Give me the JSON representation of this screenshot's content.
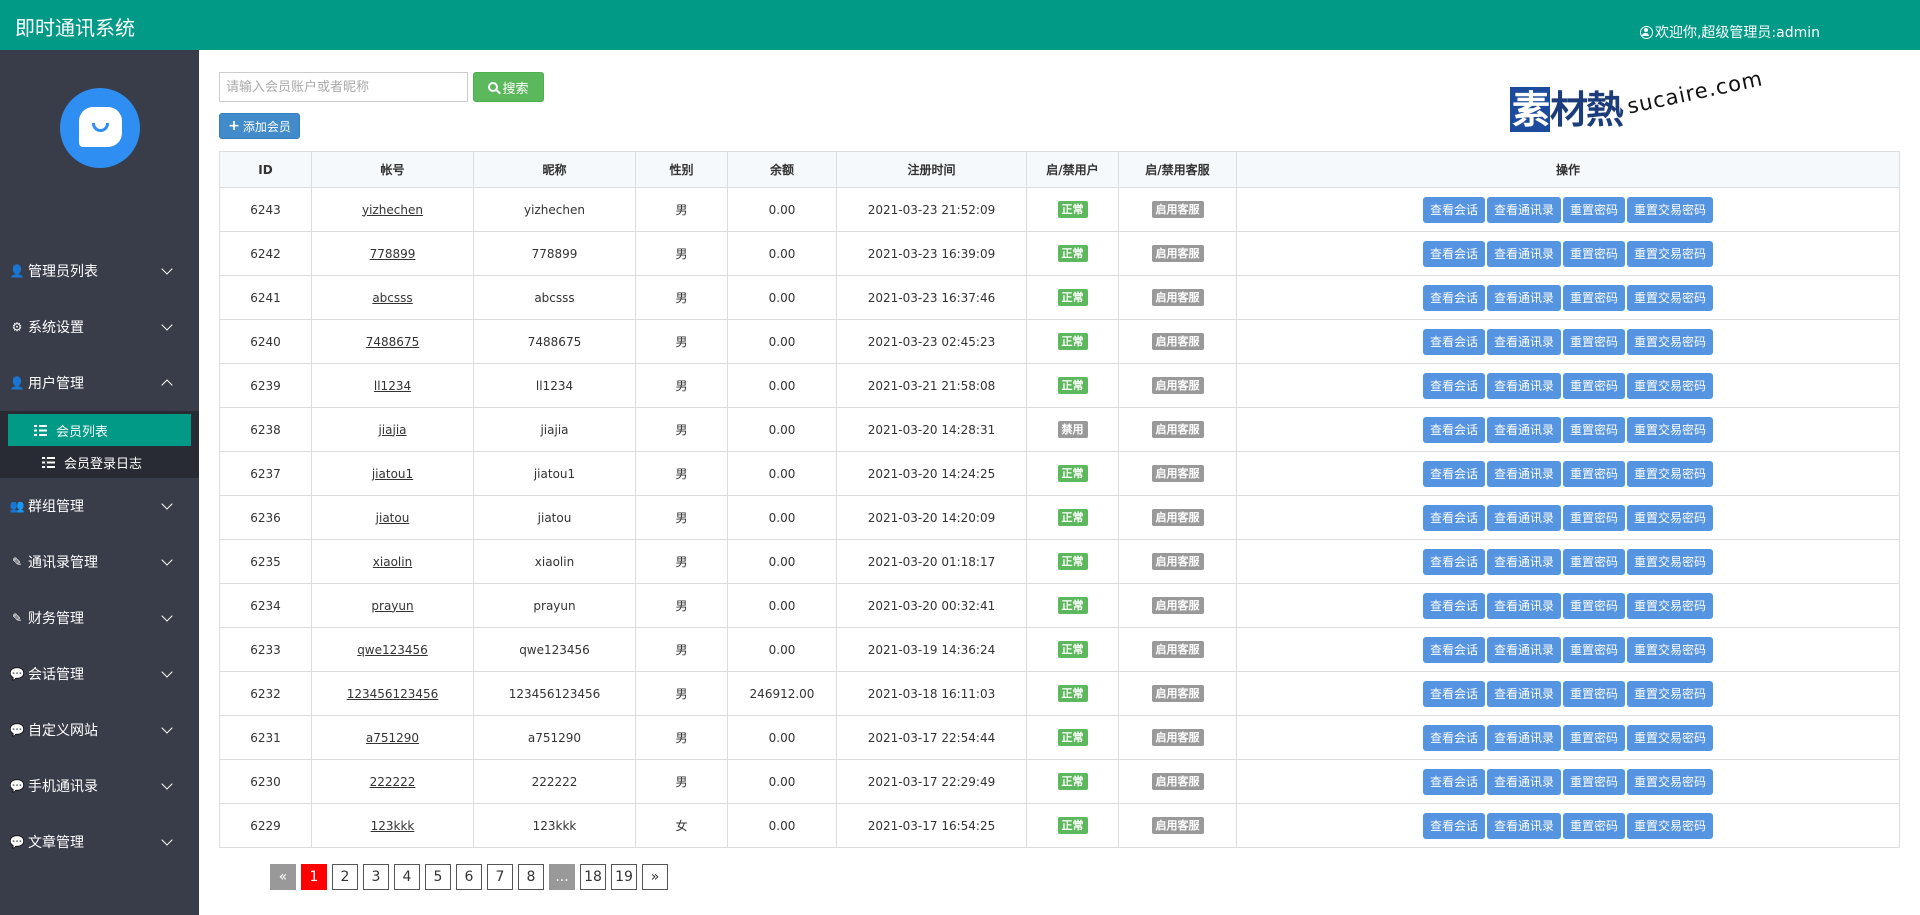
{
  "app": {
    "title": "即时通讯系统",
    "welcome": "欢迎你,超级管理员:admin",
    "accent": "#009a86"
  },
  "sidebar": {
    "items": [
      {
        "label": "管理员列表",
        "icon": "user-icon",
        "expanded": false
      },
      {
        "label": "系统设置",
        "icon": "gear-icon",
        "expanded": false
      },
      {
        "label": "用户管理",
        "icon": "user-icon",
        "expanded": true,
        "children": [
          {
            "label": "会员列表",
            "active": true
          },
          {
            "label": "会员登录日志",
            "active": false
          }
        ]
      },
      {
        "label": "群组管理",
        "icon": "group-icon",
        "expanded": false
      },
      {
        "label": "通讯录管理",
        "icon": "edit-icon",
        "expanded": false
      },
      {
        "label": "财务管理",
        "icon": "edit-icon",
        "expanded": false
      },
      {
        "label": "会话管理",
        "icon": "chat-icon",
        "expanded": false
      },
      {
        "label": "自定义网站",
        "icon": "chat-icon",
        "expanded": false
      },
      {
        "label": "手机通讯录",
        "icon": "chat-icon",
        "expanded": false
      },
      {
        "label": "文章管理",
        "icon": "chat-icon",
        "expanded": false
      }
    ]
  },
  "toolbar": {
    "search_placeholder": "请输入会员账户或者昵称",
    "search_label": "搜索",
    "add_label": "添加会员"
  },
  "watermark": {
    "logo": "素材熱",
    "logo_first": "素",
    "logo_rest": "材熱",
    "url": "sucaire.com"
  },
  "table": {
    "headers": [
      "ID",
      "帐号",
      "昵称",
      "性别",
      "余额",
      "注册时间",
      "启/禁用户",
      "启/禁用客服",
      "操作"
    ],
    "actions": [
      "查看会话",
      "查看通讯录",
      "重置密码",
      "重置交易密码"
    ],
    "rows": [
      {
        "id": "6243",
        "account": "yizhechen",
        "nickname": "yizhechen",
        "gender": "男",
        "balance": "0.00",
        "registered": "2021-03-23 21:52:09",
        "user_status": "正常",
        "user_status_ok": true,
        "cs_status": "启用客服"
      },
      {
        "id": "6242",
        "account": "778899",
        "nickname": "778899",
        "gender": "男",
        "balance": "0.00",
        "registered": "2021-03-23 16:39:09",
        "user_status": "正常",
        "user_status_ok": true,
        "cs_status": "启用客服"
      },
      {
        "id": "6241",
        "account": "abcsss",
        "nickname": "abcsss",
        "gender": "男",
        "balance": "0.00",
        "registered": "2021-03-23 16:37:46",
        "user_status": "正常",
        "user_status_ok": true,
        "cs_status": "启用客服"
      },
      {
        "id": "6240",
        "account": "7488675",
        "nickname": "7488675",
        "gender": "男",
        "balance": "0.00",
        "registered": "2021-03-23 02:45:23",
        "user_status": "正常",
        "user_status_ok": true,
        "cs_status": "启用客服"
      },
      {
        "id": "6239",
        "account": "ll1234",
        "nickname": "ll1234",
        "gender": "男",
        "balance": "0.00",
        "registered": "2021-03-21 21:58:08",
        "user_status": "正常",
        "user_status_ok": true,
        "cs_status": "启用客服"
      },
      {
        "id": "6238",
        "account": "jiajia",
        "nickname": "jiajia",
        "gender": "男",
        "balance": "0.00",
        "registered": "2021-03-20 14:28:31",
        "user_status": "禁用",
        "user_status_ok": false,
        "cs_status": "启用客服"
      },
      {
        "id": "6237",
        "account": "jiatou1",
        "nickname": "jiatou1",
        "gender": "男",
        "balance": "0.00",
        "registered": "2021-03-20 14:24:25",
        "user_status": "正常",
        "user_status_ok": true,
        "cs_status": "启用客服"
      },
      {
        "id": "6236",
        "account": "jiatou",
        "nickname": "jiatou",
        "gender": "男",
        "balance": "0.00",
        "registered": "2021-03-20 14:20:09",
        "user_status": "正常",
        "user_status_ok": true,
        "cs_status": "启用客服"
      },
      {
        "id": "6235",
        "account": "xiaolin",
        "nickname": "xiaolin",
        "gender": "男",
        "balance": "0.00",
        "registered": "2021-03-20 01:18:17",
        "user_status": "正常",
        "user_status_ok": true,
        "cs_status": "启用客服"
      },
      {
        "id": "6234",
        "account": "prayun",
        "nickname": "prayun",
        "gender": "男",
        "balance": "0.00",
        "registered": "2021-03-20 00:32:41",
        "user_status": "正常",
        "user_status_ok": true,
        "cs_status": "启用客服"
      },
      {
        "id": "6233",
        "account": "qwe123456",
        "nickname": "qwe123456",
        "gender": "男",
        "balance": "0.00",
        "registered": "2021-03-19 14:36:24",
        "user_status": "正常",
        "user_status_ok": true,
        "cs_status": "启用客服"
      },
      {
        "id": "6232",
        "account": "123456123456",
        "nickname": "123456123456",
        "gender": "男",
        "balance": "246912.00",
        "registered": "2021-03-18 16:11:03",
        "user_status": "正常",
        "user_status_ok": true,
        "cs_status": "启用客服"
      },
      {
        "id": "6231",
        "account": "a751290",
        "nickname": "a751290",
        "gender": "男",
        "balance": "0.00",
        "registered": "2021-03-17 22:54:44",
        "user_status": "正常",
        "user_status_ok": true,
        "cs_status": "启用客服"
      },
      {
        "id": "6230",
        "account": "222222",
        "nickname": "222222",
        "gender": "男",
        "balance": "0.00",
        "registered": "2021-03-17 22:29:49",
        "user_status": "正常",
        "user_status_ok": true,
        "cs_status": "启用客服"
      },
      {
        "id": "6229",
        "account": "123kkk",
        "nickname": "123kkk",
        "gender": "女",
        "balance": "0.00",
        "registered": "2021-03-17 16:54:25",
        "user_status": "正常",
        "user_status_ok": true,
        "cs_status": "启用客服"
      }
    ]
  },
  "pagination": {
    "items": [
      {
        "label": "«",
        "kind": "muted"
      },
      {
        "label": "1",
        "kind": "active"
      },
      {
        "label": "2",
        "kind": ""
      },
      {
        "label": "3",
        "kind": ""
      },
      {
        "label": "4",
        "kind": ""
      },
      {
        "label": "5",
        "kind": ""
      },
      {
        "label": "6",
        "kind": ""
      },
      {
        "label": "7",
        "kind": ""
      },
      {
        "label": "8",
        "kind": ""
      },
      {
        "label": "...",
        "kind": "muted"
      },
      {
        "label": "18",
        "kind": ""
      },
      {
        "label": "19",
        "kind": ""
      },
      {
        "label": "»",
        "kind": ""
      }
    ]
  }
}
